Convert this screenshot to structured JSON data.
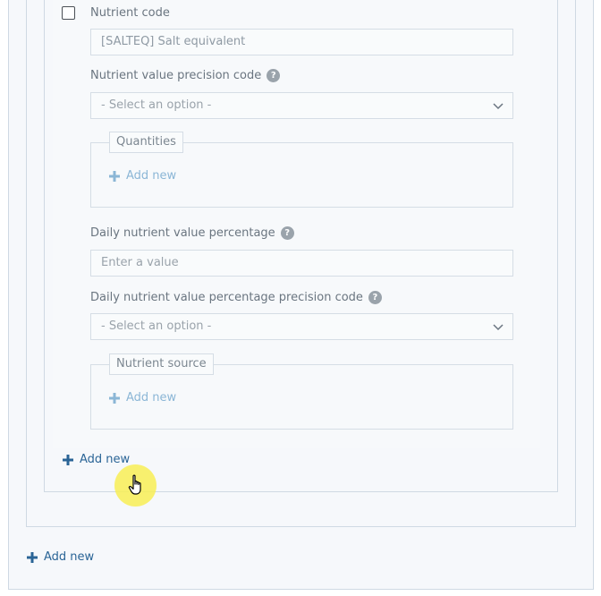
{
  "nutrient_code": {
    "label": "Nutrient code",
    "value": "[SALTEQ] Salt equivalent"
  },
  "precision_code": {
    "label": "Nutrient value precision code",
    "help": "?",
    "placeholder": "- Select an option -"
  },
  "quantities": {
    "legend": "Quantities",
    "add_label": "Add new"
  },
  "daily_percentage": {
    "label": "Daily nutrient value percentage",
    "help": "?",
    "placeholder": "Enter a value"
  },
  "daily_precision_code": {
    "label": "Daily nutrient value percentage precision code",
    "help": "?",
    "placeholder": "- Select an option -"
  },
  "nutrient_source": {
    "legend": "Nutrient source",
    "add_label": "Add new"
  },
  "inner_add_label": "Add new",
  "outer_add_label": "Add new",
  "colors": {
    "link_dark": "#2a6496",
    "link_light": "#8bb6d6",
    "cursor_highlight": "#f8ef55"
  }
}
